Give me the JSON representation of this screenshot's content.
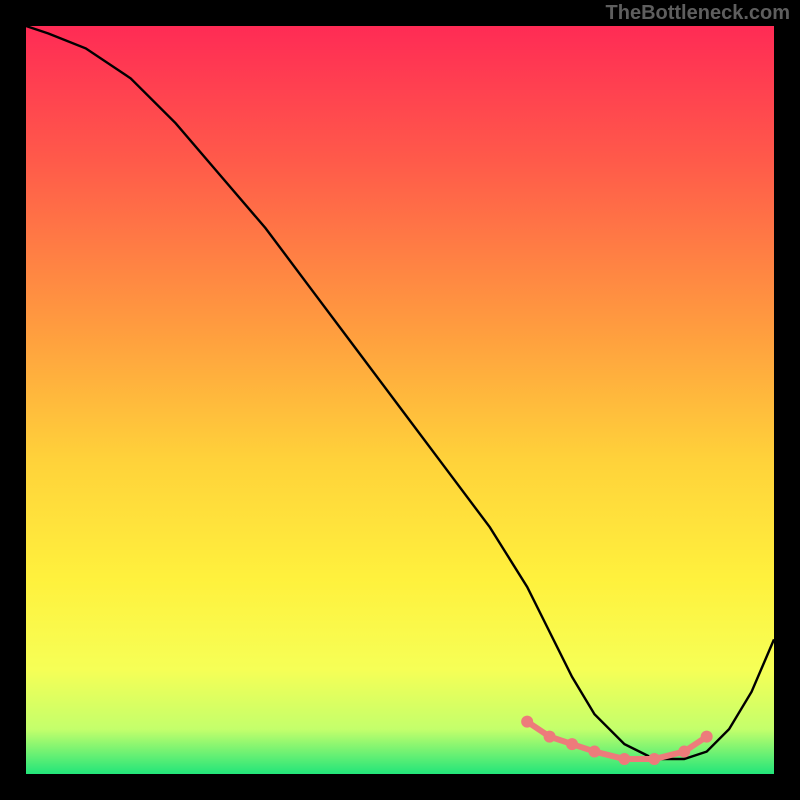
{
  "watermark": "TheBottleneck.com",
  "chart_data": {
    "type": "line",
    "title": "",
    "xlabel": "",
    "ylabel": "",
    "xlim": [
      0,
      100
    ],
    "ylim": [
      0,
      100
    ],
    "background_gradient": {
      "stops": [
        {
          "offset": 0,
          "color": "#ff2b55"
        },
        {
          "offset": 18,
          "color": "#ff5a4a"
        },
        {
          "offset": 40,
          "color": "#ff9b3f"
        },
        {
          "offset": 58,
          "color": "#ffd23a"
        },
        {
          "offset": 74,
          "color": "#fff13d"
        },
        {
          "offset": 86,
          "color": "#f6ff56"
        },
        {
          "offset": 94,
          "color": "#c4ff6b"
        },
        {
          "offset": 100,
          "color": "#22e57a"
        }
      ]
    },
    "series": [
      {
        "name": "bottleneck-curve",
        "color": "#000000",
        "x": [
          0,
          3,
          8,
          14,
          20,
          26,
          32,
          38,
          44,
          50,
          56,
          62,
          67,
          70,
          73,
          76,
          80,
          84,
          88,
          91,
          94,
          97,
          100
        ],
        "y": [
          100,
          99,
          97,
          93,
          87,
          80,
          73,
          65,
          57,
          49,
          41,
          33,
          25,
          19,
          13,
          8,
          4,
          2,
          2,
          3,
          6,
          11,
          18
        ]
      }
    ],
    "highlight": {
      "name": "optimal-range",
      "color": "#ed7b7b",
      "points_x": [
        67,
        70,
        73,
        76,
        80,
        84,
        88,
        91
      ],
      "points_y": [
        7,
        5,
        4,
        3,
        2,
        2,
        3,
        5
      ]
    }
  }
}
